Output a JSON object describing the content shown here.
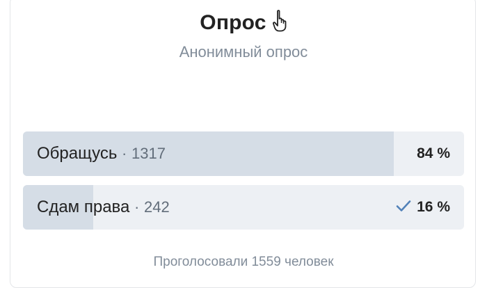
{
  "poll": {
    "title": "Опрос",
    "title_emoji_icon": "pointing-up-hand-icon",
    "subtitle": "Анонимный опрос",
    "options": [
      {
        "label": "Обращусь",
        "separator": "·",
        "votes": "1317",
        "percent_label": "84 %",
        "fill_fraction": 0.84,
        "voted": false
      },
      {
        "label": "Сдам права",
        "separator": "·",
        "votes": "242",
        "percent_label": "16 %",
        "fill_fraction": 0.16,
        "voted": true,
        "voted_icon": "checkmark-icon"
      }
    ],
    "footer": "Проголосовали 1559 человек",
    "colors": {
      "option_background": "#edf0f4",
      "option_fill": "#d5dde6",
      "checkmark": "#5181b8",
      "muted_text": "#818c99"
    }
  }
}
